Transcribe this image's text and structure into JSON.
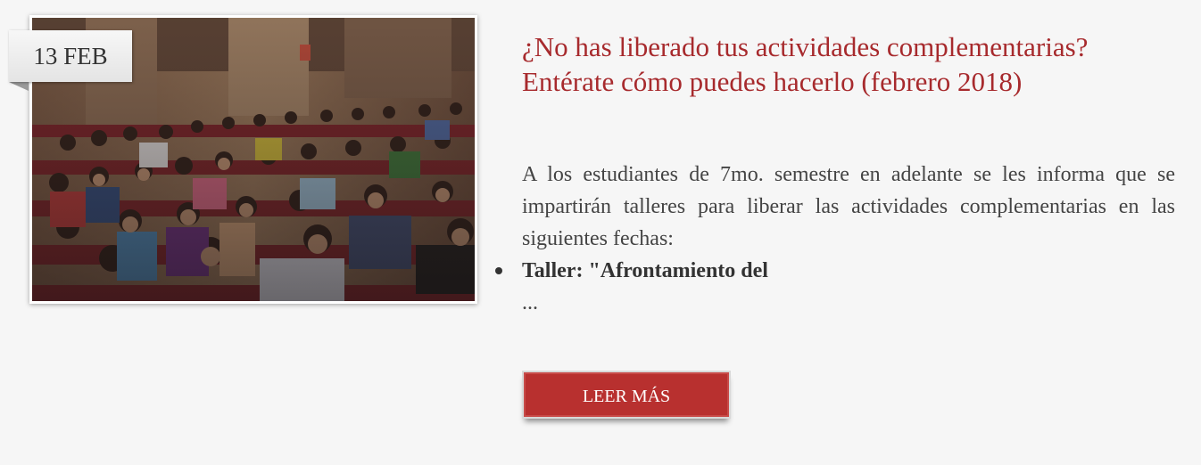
{
  "post": {
    "date": "13 FEB",
    "title": "¿No has liberado tus actividades complementarias? Entérate cómo puedes hacerlo (febrero 2018)",
    "excerpt": "A los estudiantes de 7mo. semestre en adelante se les informa que se impartirán talleres para liberar las actividades complementarias en las siguientes fechas:",
    "bullets": [
      {
        "text": "Taller: \"Afrontamiento del"
      }
    ],
    "ellipsis": "...",
    "read_more_label": "LEER MÁS"
  },
  "colors": {
    "title": "#a72a2d",
    "button": "#b8302f",
    "background": "#f6f6f6"
  }
}
